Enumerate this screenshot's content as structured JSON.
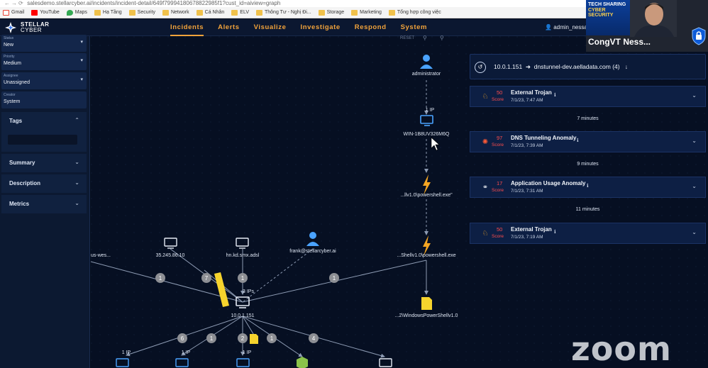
{
  "browser": {
    "url": "salesdemo.stellarcyber.ai/incidents/incident-detail/649f79994180678822985f1?cust_id=aiview=graph",
    "bookmarks": [
      "Gmail",
      "YouTube",
      "Maps",
      "Hạ Tầng",
      "Security",
      "Network",
      "Cá Nhân",
      "ELV",
      "Thông Tư - Nghị Đi...",
      "Storage",
      "Marketing",
      "Tổng hợp công việc"
    ]
  },
  "app": {
    "brand_line1": "STELLAR",
    "brand_line2": "CYBER",
    "nav": [
      "Incidents",
      "Alerts",
      "Visualize",
      "Investigate",
      "Respond",
      "System"
    ],
    "active_nav": "Incidents",
    "user": "admin_nessar"
  },
  "leftpanel": {
    "fields": [
      {
        "label": "Status",
        "value": "New"
      },
      {
        "label": "Priority",
        "value": "Medium"
      },
      {
        "label": "Assignee",
        "value": "Unassigned"
      },
      {
        "label": "Creator",
        "value": "System"
      }
    ],
    "sections": [
      "Tags",
      "Summary",
      "Description",
      "Metrics"
    ]
  },
  "graph": {
    "top_controls": "RESET",
    "nodes": {
      "administrator": "administrator",
      "ip_label_1": "1 IP",
      "win_host": "WIN-1B8UV326M6Q",
      "ps1": "...llv1.0\\powershell.exe\"",
      "us_wes": "us-wes...",
      "ip_35": "35.245.86.10",
      "hn_kd": "hn.kd.smx.adsl",
      "frank": "frank@stellarcyber.ai",
      "ps2": "...Shellv1.0\\powershell.exe",
      "ips_label": "3 IPs",
      "host_10": "10.0.1.151",
      "file_win": "...2\\WindowsPowerShellv1.0",
      "bottom_ip_a": "1 IP",
      "bottom_ip_b": "1 IP",
      "bottom_ip_c": "1 IP"
    },
    "edge_badges": [
      "1",
      "7",
      "1",
      "1",
      "6",
      "1",
      "2",
      "1",
      "4"
    ]
  },
  "alertpanel": {
    "header_ip": "10.0.1.151",
    "header_domain": "dnstunnel-dev.aelladata.com",
    "header_count": "(4)",
    "alerts": [
      {
        "score": "50",
        "score_label": "Score",
        "title": "External Trojan",
        "timestamp": "7/1/23, 7:47 AM",
        "icon": "trojan-horse-icon"
      },
      {
        "score": "97",
        "score_label": "Score",
        "title": "DNS Tunneling Anomaly",
        "timestamp": "7/1/23, 7:39 AM",
        "icon": "starburst-icon"
      },
      {
        "score": "17",
        "score_label": "Score",
        "title": "Application Usage Anomaly",
        "timestamp": "7/1/23, 7:31 AM",
        "icon": "binoculars-icon"
      },
      {
        "score": "50",
        "score_label": "Score",
        "title": "External Trojan",
        "timestamp": "7/1/23, 7:19 AM",
        "icon": "trojan-horse-icon"
      }
    ],
    "gaps": [
      "7 minutes",
      "9 minutes",
      "11 minutes"
    ]
  },
  "video": {
    "banner_line1": "TECH SHARING",
    "banner_line2": "CYBER SECURITY",
    "name": "CongVT Ness..."
  },
  "watermark": "zoom",
  "colors": {
    "accent": "#f2a33b",
    "score_red": "#ff4d4d",
    "node_blue": "#4aa3ff",
    "badge_gray": "#8d8f94"
  }
}
